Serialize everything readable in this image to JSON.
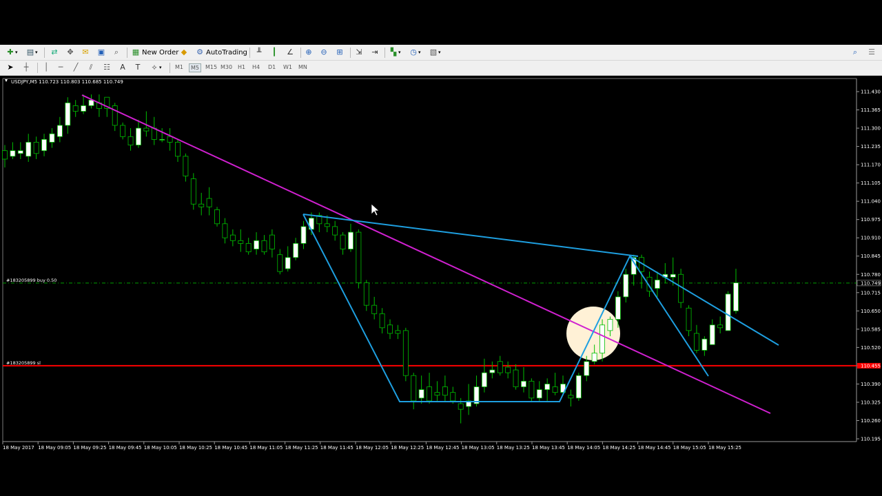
{
  "toolbar": {
    "new_order_label": "New Order",
    "autotrading_label": "AutoTrading",
    "timeframes": [
      "M1",
      "M5",
      "M15",
      "M30",
      "H1",
      "H4",
      "D1",
      "W1",
      "MN"
    ],
    "active_timeframe": "M5"
  },
  "chart": {
    "header": "USDJPY,M5  110.723 110.803 110.685 110.749",
    "buy_label": "#183205899 buy 0.50",
    "sl_label": "#183205899 sl",
    "buy_price": "110.749",
    "sl_price": "110.455",
    "colors": {
      "bull": "#ffffff",
      "bear": "#000000",
      "wick": "#00c000",
      "trendline_main": "#d020d0",
      "channel": "#1e9fe0",
      "sl_line": "#ff0000",
      "buy_line": "#00a000",
      "highlight": "#fff1d6"
    }
  },
  "chart_data": {
    "type": "candlestick",
    "symbol": "USDJPY",
    "timeframe": "M5",
    "ylim": [
      110.195,
      111.43
    ],
    "y_ticks": [
      "111.430",
      "111.365",
      "111.300",
      "111.235",
      "111.170",
      "111.105",
      "111.040",
      "110.975",
      "110.910",
      "110.845",
      "110.780",
      "110.715",
      "110.650",
      "110.585",
      "110.520",
      "110.455",
      "110.390",
      "110.325",
      "110.260",
      "110.195"
    ],
    "x_ticks": [
      "18 May 2017",
      "18 May 09:05",
      "18 May 09:25",
      "18 May 09:45",
      "18 May 10:05",
      "18 May 10:25",
      "18 May 10:45",
      "18 May 11:05",
      "18 May 11:25",
      "18 May 11:45",
      "18 May 12:05",
      "18 May 12:25",
      "18 May 12:45",
      "18 May 13:05",
      "18 May 13:25",
      "18 May 13:45",
      "18 May 14:05",
      "18 May 14:25",
      "18 May 14:45",
      "18 May 15:05",
      "18 May 15:25"
    ],
    "candles": [
      [
        111.22,
        111.19,
        111.24,
        111.16
      ],
      [
        111.2,
        111.22,
        111.25,
        111.19
      ],
      [
        111.21,
        111.22,
        111.25,
        111.19
      ],
      [
        111.2,
        111.25,
        111.28,
        111.18
      ],
      [
        111.25,
        111.21,
        111.27,
        111.19
      ],
      [
        111.22,
        111.26,
        111.28,
        111.2
      ],
      [
        111.25,
        111.28,
        111.3,
        111.23
      ],
      [
        111.27,
        111.31,
        111.34,
        111.25
      ],
      [
        111.31,
        111.39,
        111.41,
        111.28
      ],
      [
        111.38,
        111.36,
        111.4,
        111.34
      ],
      [
        111.36,
        111.38,
        111.42,
        111.35
      ],
      [
        111.38,
        111.4,
        111.42,
        111.37
      ],
      [
        111.39,
        111.37,
        111.42,
        111.34
      ],
      [
        111.41,
        111.37,
        111.41,
        111.34
      ],
      [
        111.38,
        111.31,
        111.39,
        111.29
      ],
      [
        111.31,
        111.27,
        111.32,
        111.26
      ],
      [
        111.27,
        111.24,
        111.3,
        111.22
      ],
      [
        111.24,
        111.3,
        111.33,
        111.23
      ],
      [
        111.3,
        111.29,
        111.36,
        111.27
      ],
      [
        111.3,
        111.26,
        111.34,
        111.24
      ],
      [
        111.26,
        111.26,
        111.3,
        111.25
      ],
      [
        111.27,
        111.25,
        111.3,
        111.22
      ],
      [
        111.25,
        111.2,
        111.26,
        111.18
      ],
      [
        111.2,
        111.13,
        111.21,
        111.11
      ],
      [
        111.12,
        111.03,
        111.14,
        111.01
      ],
      [
        111.03,
        111.02,
        111.07,
        110.99
      ],
      [
        111.05,
        111.02,
        111.09,
        110.99
      ],
      [
        111.01,
        110.96,
        111.02,
        110.95
      ],
      [
        110.96,
        110.91,
        110.98,
        110.89
      ],
      [
        110.92,
        110.9,
        110.94,
        110.88
      ],
      [
        110.9,
        110.89,
        110.94,
        110.86
      ],
      [
        110.89,
        110.86,
        110.91,
        110.85
      ],
      [
        110.87,
        110.9,
        110.93,
        110.85
      ],
      [
        110.9,
        110.86,
        110.92,
        110.85
      ],
      [
        110.92,
        110.87,
        110.94,
        110.84
      ],
      [
        110.85,
        110.79,
        110.87,
        110.78
      ],
      [
        110.8,
        110.84,
        110.88,
        110.79
      ],
      [
        110.84,
        110.89,
        110.91,
        110.83
      ],
      [
        110.89,
        110.95,
        110.97,
        110.87
      ],
      [
        110.94,
        110.98,
        111.0,
        110.92
      ],
      [
        110.99,
        110.96,
        111.0,
        110.93
      ],
      [
        110.96,
        110.95,
        110.99,
        110.93
      ],
      [
        110.95,
        110.92,
        110.97,
        110.9
      ],
      [
        110.92,
        110.87,
        110.93,
        110.85
      ],
      [
        110.87,
        110.93,
        110.96,
        110.86
      ],
      [
        110.93,
        110.75,
        110.94,
        110.73
      ],
      [
        110.75,
        110.67,
        110.76,
        110.65
      ],
      [
        110.67,
        110.64,
        110.7,
        110.62
      ],
      [
        110.64,
        110.59,
        110.66,
        110.57
      ],
      [
        110.6,
        110.57,
        110.62,
        110.55
      ],
      [
        110.58,
        110.57,
        110.6,
        110.55
      ],
      [
        110.58,
        110.42,
        110.59,
        110.4
      ],
      [
        110.42,
        110.33,
        110.43,
        110.3
      ],
      [
        110.34,
        110.37,
        110.42,
        110.32
      ],
      [
        110.38,
        110.33,
        110.43,
        110.32
      ],
      [
        110.36,
        110.35,
        110.4,
        110.33
      ],
      [
        110.38,
        110.35,
        110.42,
        110.33
      ],
      [
        110.36,
        110.33,
        110.38,
        110.32
      ],
      [
        110.32,
        110.3,
        110.34,
        110.25
      ],
      [
        110.31,
        110.33,
        110.39,
        110.28
      ],
      [
        110.32,
        110.38,
        110.42,
        110.31
      ],
      [
        110.38,
        110.43,
        110.48,
        110.36
      ],
      [
        110.43,
        110.44,
        110.47,
        110.41
      ],
      [
        110.47,
        110.43,
        110.49,
        110.42
      ],
      [
        110.45,
        110.43,
        110.47,
        110.41
      ],
      [
        110.44,
        110.38,
        110.46,
        110.37
      ],
      [
        110.38,
        110.4,
        110.45,
        110.36
      ],
      [
        110.4,
        110.34,
        110.41,
        110.33
      ],
      [
        110.34,
        110.37,
        110.4,
        110.33
      ],
      [
        110.37,
        110.39,
        110.41,
        110.33
      ],
      [
        110.38,
        110.36,
        110.43,
        110.35
      ],
      [
        110.36,
        110.39,
        110.42,
        110.35
      ],
      [
        110.35,
        110.34,
        110.37,
        110.31
      ],
      [
        110.34,
        110.42,
        110.43,
        110.33
      ],
      [
        110.42,
        110.47,
        110.49,
        110.4
      ],
      [
        110.47,
        110.5,
        110.53,
        110.46
      ],
      [
        110.5,
        110.6,
        110.62,
        110.47
      ],
      [
        110.58,
        110.62,
        110.63,
        110.56
      ],
      [
        110.62,
        110.7,
        110.72,
        110.59
      ],
      [
        110.7,
        110.78,
        110.8,
        110.68
      ],
      [
        110.78,
        110.84,
        110.85,
        110.74
      ],
      [
        110.84,
        110.79,
        110.85,
        110.73
      ],
      [
        110.77,
        110.72,
        110.79,
        110.7
      ],
      [
        110.73,
        110.76,
        110.79,
        110.7
      ],
      [
        110.77,
        110.78,
        110.82,
        110.75
      ],
      [
        110.77,
        110.78,
        110.84,
        110.74
      ],
      [
        110.78,
        110.68,
        110.8,
        110.66
      ],
      [
        110.66,
        110.58,
        110.67,
        110.56
      ],
      [
        110.57,
        110.51,
        110.6,
        110.5
      ],
      [
        110.51,
        110.55,
        110.56,
        110.49
      ],
      [
        110.53,
        110.6,
        110.62,
        110.53
      ],
      [
        110.6,
        110.59,
        110.63,
        110.57
      ],
      [
        110.58,
        110.71,
        110.72,
        110.58
      ],
      [
        110.65,
        110.75,
        110.8,
        110.64
      ]
    ],
    "drawings": [
      {
        "type": "trendline",
        "color": "#d020d0",
        "from": [
          "18 May 09:25",
          111.41
        ],
        "to": [
          "18 May 15:25+",
          110.29
        ]
      },
      {
        "type": "channel",
        "color": "#1e9fe0",
        "points": "W pattern"
      }
    ]
  }
}
